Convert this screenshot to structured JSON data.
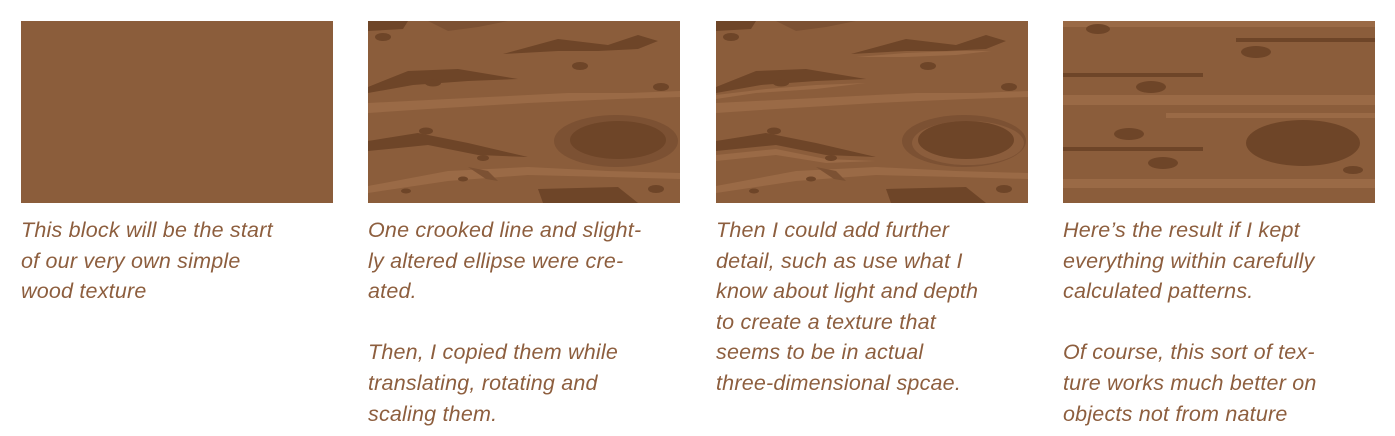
{
  "colors": {
    "wood_base": "#8b5d3b",
    "wood_dark": "#6e4528",
    "wood_mid": "#7c5133",
    "wood_light": "#9a6a46",
    "caption_text": "#8d5e3e"
  },
  "panels": [
    {
      "caption": [
        "This block will be the start\nof our very own simple\nwood texture"
      ]
    },
    {
      "caption": [
        "One crooked line and slight-\nly altered ellipse were cre-\nated.",
        "Then, I copied them while\ntranslating, rotating and\nscaling them."
      ]
    },
    {
      "caption": [
        "Then I could add further\ndetail, such as use what I\nknow about light and depth\nto create a texture that\nseems to be in actual\nthree-dimensional spcae."
      ]
    },
    {
      "caption": [
        "Here’s the result if I kept\neverything within carefully\ncalculated patterns.",
        "Of course, this sort of tex-\nture works much better on\nobjects not from nature"
      ]
    }
  ]
}
